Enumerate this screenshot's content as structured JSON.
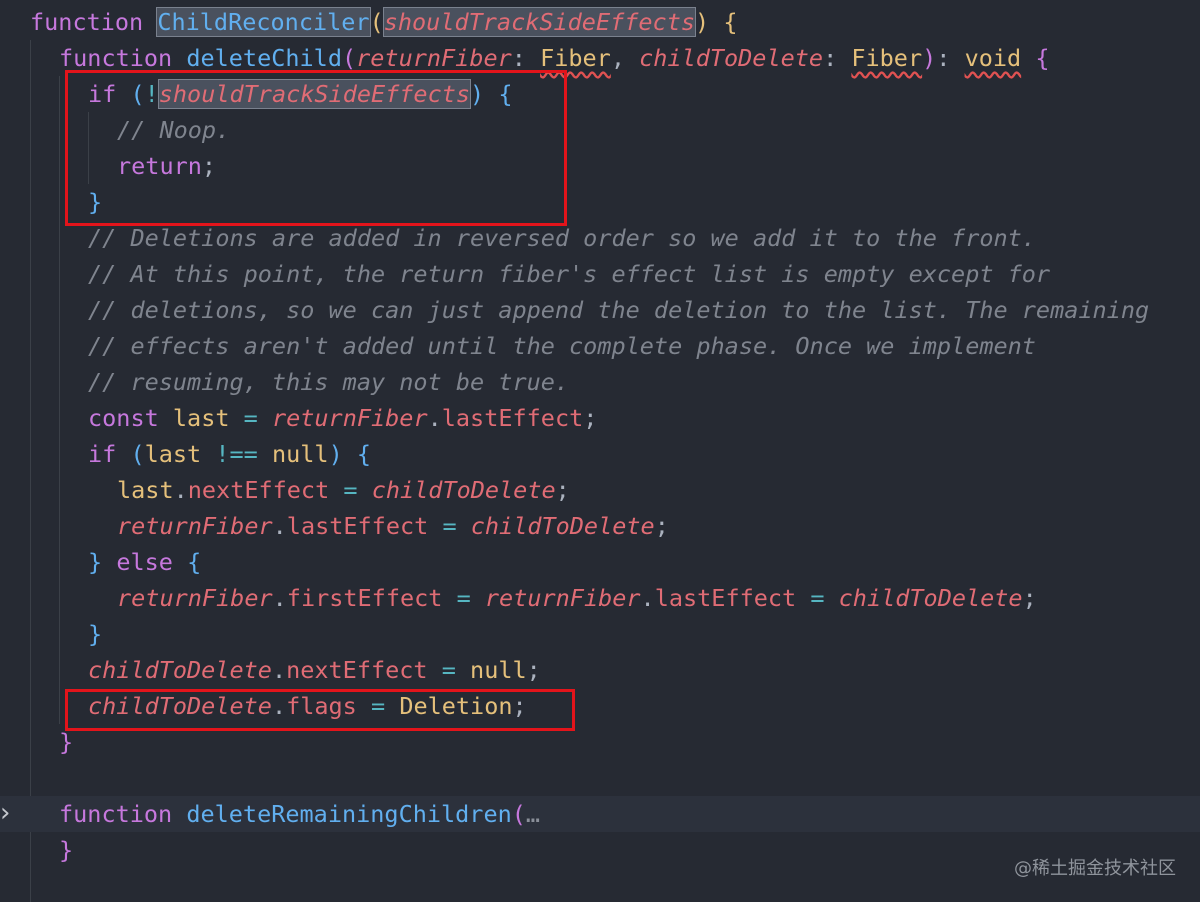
{
  "editor": {
    "lines": [
      {
        "indent": 0,
        "tokens": [
          {
            "t": "function",
            "c": "kw"
          },
          {
            "t": " "
          },
          {
            "t": "ChildReconciler",
            "c": "fn hl"
          },
          {
            "t": "(",
            "c": "brace1"
          },
          {
            "t": "shouldTrackSideEffects",
            "c": "param hl"
          },
          {
            "t": ")",
            "c": "brace1"
          },
          {
            "t": " "
          },
          {
            "t": "{",
            "c": "brace1"
          }
        ]
      },
      {
        "indent": 1,
        "tokens": [
          {
            "t": "function",
            "c": "kw"
          },
          {
            "t": " "
          },
          {
            "t": "deleteChild",
            "c": "fn"
          },
          {
            "t": "(",
            "c": "brace2"
          },
          {
            "t": "returnFiber",
            "c": "param"
          },
          {
            "t": ": ",
            "c": "punc"
          },
          {
            "t": "Fiber",
            "c": "type squig"
          },
          {
            "t": ", ",
            "c": "punc"
          },
          {
            "t": "childToDelete",
            "c": "param"
          },
          {
            "t": ": ",
            "c": "punc"
          },
          {
            "t": "Fiber",
            "c": "type squig"
          },
          {
            "t": ")",
            "c": "brace2"
          },
          {
            "t": ": ",
            "c": "punc"
          },
          {
            "t": "void",
            "c": "type squig"
          },
          {
            "t": " "
          },
          {
            "t": "{",
            "c": "brace2"
          }
        ]
      },
      {
        "indent": 2,
        "tokens": [
          {
            "t": "if",
            "c": "kw"
          },
          {
            "t": " "
          },
          {
            "t": "(",
            "c": "brace3"
          },
          {
            "t": "!",
            "c": "op"
          },
          {
            "t": "shouldTrackSideEffects",
            "c": "param hl"
          },
          {
            "t": ")",
            "c": "brace3"
          },
          {
            "t": " "
          },
          {
            "t": "{",
            "c": "brace3"
          }
        ]
      },
      {
        "indent": 3,
        "tokens": [
          {
            "t": "// Noop.",
            "c": "comment"
          }
        ]
      },
      {
        "indent": 3,
        "tokens": [
          {
            "t": "return",
            "c": "kw"
          },
          {
            "t": ";",
            "c": "punc"
          }
        ]
      },
      {
        "indent": 2,
        "tokens": [
          {
            "t": "}",
            "c": "brace3"
          }
        ]
      },
      {
        "indent": 2,
        "tokens": [
          {
            "t": "// Deletions are added in reversed order so we add it to the front.",
            "c": "comment"
          }
        ]
      },
      {
        "indent": 2,
        "tokens": [
          {
            "t": "// At this point, the return fiber's effect list is empty except for",
            "c": "comment"
          }
        ]
      },
      {
        "indent": 2,
        "tokens": [
          {
            "t": "// deletions, so we can just append the deletion to the list. The remaining",
            "c": "comment"
          }
        ]
      },
      {
        "indent": 2,
        "tokens": [
          {
            "t": "// effects aren't added until the complete phase. Once we implement",
            "c": "comment"
          }
        ]
      },
      {
        "indent": 2,
        "tokens": [
          {
            "t": "// resuming, this may not be true.",
            "c": "comment"
          }
        ]
      },
      {
        "indent": 2,
        "tokens": [
          {
            "t": "const",
            "c": "kw"
          },
          {
            "t": " "
          },
          {
            "t": "last",
            "c": "const"
          },
          {
            "t": " "
          },
          {
            "t": "=",
            "c": "op"
          },
          {
            "t": " "
          },
          {
            "t": "returnFiber",
            "c": "param"
          },
          {
            "t": ".",
            "c": "punc"
          },
          {
            "t": "lastEffect",
            "c": "prop"
          },
          {
            "t": ";",
            "c": "punc"
          }
        ]
      },
      {
        "indent": 2,
        "tokens": [
          {
            "t": "if",
            "c": "kw"
          },
          {
            "t": " "
          },
          {
            "t": "(",
            "c": "brace3"
          },
          {
            "t": "last",
            "c": "const"
          },
          {
            "t": " "
          },
          {
            "t": "!==",
            "c": "op"
          },
          {
            "t": " "
          },
          {
            "t": "null",
            "c": "type"
          },
          {
            "t": ")",
            "c": "brace3"
          },
          {
            "t": " "
          },
          {
            "t": "{",
            "c": "brace3"
          }
        ]
      },
      {
        "indent": 3,
        "tokens": [
          {
            "t": "last",
            "c": "const"
          },
          {
            "t": ".",
            "c": "punc"
          },
          {
            "t": "nextEffect",
            "c": "prop"
          },
          {
            "t": " "
          },
          {
            "t": "=",
            "c": "op"
          },
          {
            "t": " "
          },
          {
            "t": "childToDelete",
            "c": "param"
          },
          {
            "t": ";",
            "c": "punc"
          }
        ]
      },
      {
        "indent": 3,
        "tokens": [
          {
            "t": "returnFiber",
            "c": "param"
          },
          {
            "t": ".",
            "c": "punc"
          },
          {
            "t": "lastEffect",
            "c": "prop"
          },
          {
            "t": " "
          },
          {
            "t": "=",
            "c": "op"
          },
          {
            "t": " "
          },
          {
            "t": "childToDelete",
            "c": "param"
          },
          {
            "t": ";",
            "c": "punc"
          }
        ]
      },
      {
        "indent": 2,
        "tokens": [
          {
            "t": "}",
            "c": "brace3"
          },
          {
            "t": " "
          },
          {
            "t": "else",
            "c": "kw"
          },
          {
            "t": " "
          },
          {
            "t": "{",
            "c": "brace3"
          }
        ]
      },
      {
        "indent": 3,
        "tokens": [
          {
            "t": "returnFiber",
            "c": "param"
          },
          {
            "t": ".",
            "c": "punc"
          },
          {
            "t": "firstEffect",
            "c": "prop"
          },
          {
            "t": " "
          },
          {
            "t": "=",
            "c": "op"
          },
          {
            "t": " "
          },
          {
            "t": "returnFiber",
            "c": "param"
          },
          {
            "t": ".",
            "c": "punc"
          },
          {
            "t": "lastEffect",
            "c": "prop"
          },
          {
            "t": " "
          },
          {
            "t": "=",
            "c": "op"
          },
          {
            "t": " "
          },
          {
            "t": "childToDelete",
            "c": "param"
          },
          {
            "t": ";",
            "c": "punc"
          }
        ]
      },
      {
        "indent": 2,
        "tokens": [
          {
            "t": "}",
            "c": "brace3"
          }
        ]
      },
      {
        "indent": 2,
        "tokens": [
          {
            "t": "childToDelete",
            "c": "param"
          },
          {
            "t": ".",
            "c": "punc"
          },
          {
            "t": "nextEffect",
            "c": "prop"
          },
          {
            "t": " "
          },
          {
            "t": "=",
            "c": "op"
          },
          {
            "t": " "
          },
          {
            "t": "null",
            "c": "type"
          },
          {
            "t": ";",
            "c": "punc"
          }
        ]
      },
      {
        "indent": 2,
        "tokens": [
          {
            "t": "childToDelete",
            "c": "param"
          },
          {
            "t": ".",
            "c": "punc"
          },
          {
            "t": "flags",
            "c": "prop"
          },
          {
            "t": " "
          },
          {
            "t": "=",
            "c": "op"
          },
          {
            "t": " "
          },
          {
            "t": "Deletion",
            "c": "const"
          },
          {
            "t": ";",
            "c": "punc"
          }
        ]
      },
      {
        "indent": 1,
        "tokens": [
          {
            "t": "}",
            "c": "brace2"
          }
        ]
      },
      {
        "indent": 0,
        "tokens": []
      },
      {
        "indent": 1,
        "folded": true,
        "tokens": [
          {
            "t": "function",
            "c": "kw"
          },
          {
            "t": " "
          },
          {
            "t": "deleteRemainingChildren",
            "c": "fn"
          },
          {
            "t": "(",
            "c": "brace2"
          },
          {
            "t": "…",
            "c": "ellipsis"
          }
        ]
      },
      {
        "indent": 1,
        "tokens": [
          {
            "t": "}",
            "c": "brace2"
          }
        ]
      }
    ]
  },
  "fold_chevron": "›",
  "watermark": "@稀土掘金技术社区"
}
